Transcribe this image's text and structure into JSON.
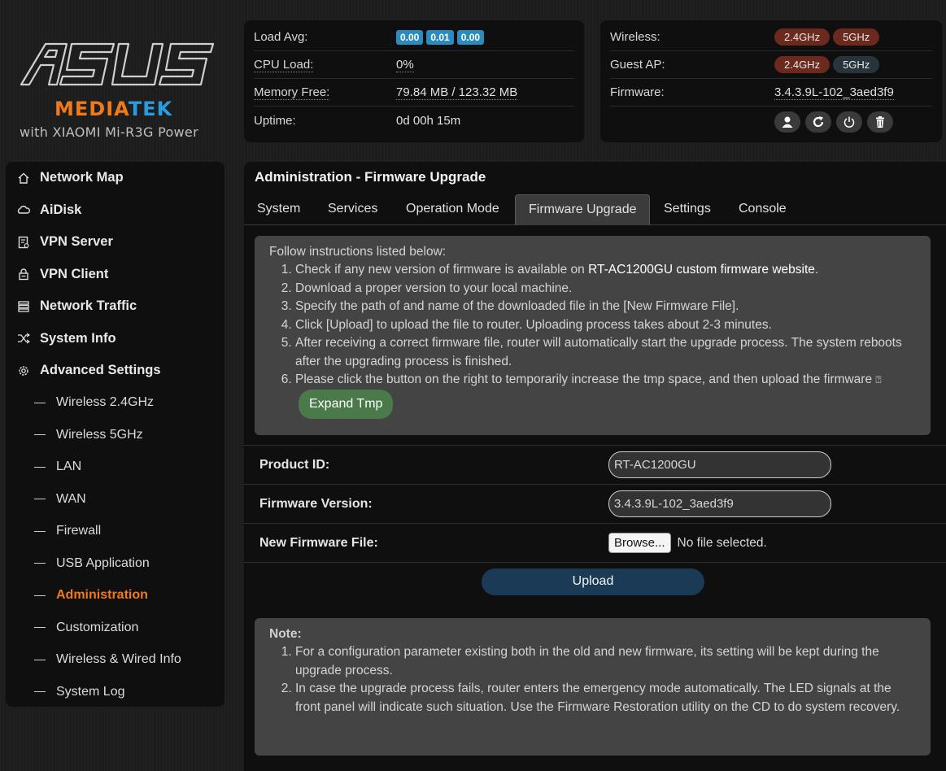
{
  "branding": {
    "logo_text": "ASUS",
    "mediatek_a": "MEDIA",
    "mediatek_b": "TEK",
    "tagline": "with XIAOMI Mi-R3G Power"
  },
  "status_left": {
    "load_avg_label": "Load Avg:",
    "load_avg_values": [
      "0.00",
      "0.01",
      "0.00"
    ],
    "cpu_label": "CPU Load:",
    "cpu_value": "0%",
    "mem_label": "Memory Free:",
    "mem_value": "79.84 MB / 123.32 MB",
    "uptime_label": "Uptime:",
    "uptime_value": "0d 00h 15m"
  },
  "status_right": {
    "wireless_label": "Wireless:",
    "wireless_24": "2.4GHz",
    "wireless_5": "5GHz",
    "guest_label": "Guest AP:",
    "guest_24": "2.4GHz",
    "guest_5": "5GHz",
    "firmware_label": "Firmware:",
    "firmware_value": "3.4.3.9L-102_3aed3f9",
    "icons": [
      "user-icon",
      "refresh-icon",
      "power-icon",
      "trash-icon"
    ]
  },
  "sidebar": {
    "items": [
      {
        "label": "Network Map",
        "icon": "home-icon"
      },
      {
        "label": "AiDisk",
        "icon": "cloud-icon"
      },
      {
        "label": "VPN Server",
        "icon": "vpn-server-icon"
      },
      {
        "label": "VPN Client",
        "icon": "lock-icon"
      },
      {
        "label": "Network Traffic",
        "icon": "list-icon"
      },
      {
        "label": "System Info",
        "icon": "shuffle-icon"
      },
      {
        "label": "Advanced Settings",
        "icon": "gear-icon"
      }
    ],
    "sub_items": [
      "Wireless 2.4GHz",
      "Wireless 5GHz",
      "LAN",
      "WAN",
      "Firewall",
      "USB Application",
      "Administration",
      "Customization",
      "Wireless & Wired Info",
      "System Log"
    ],
    "active_sub": "Administration"
  },
  "main": {
    "title": "Administration - Firmware Upgrade",
    "tabs": [
      "System",
      "Services",
      "Operation Mode",
      "Firmware Upgrade",
      "Settings",
      "Console"
    ],
    "active_tab": "Firmware Upgrade",
    "instructions": {
      "head": "Follow instructions listed below:",
      "step1_a": "Check if any new version of firmware is available on ",
      "step1_link": "RT-AC1200GU custom firmware website",
      "step1_b": ".",
      "step2": "Download a proper version to your local machine.",
      "step3": "Specify the path of and name of the downloaded file in the [New Firmware File].",
      "step4": "Click [Upload] to upload the file to router. Uploading process takes about 2-3 minutes.",
      "step5": "After receiving a correct firmware file, router will automatically start the upgrade process. The system reboots after the upgrading process is finished.",
      "step6": "Please click the button on the right to temporarily increase the tmp space, and then upload the firmware",
      "step6_glyph": "⍰",
      "expand_button": "Expand Tmp"
    },
    "form": {
      "product_id_label": "Product ID:",
      "product_id_value": "RT-AC1200GU",
      "fw_version_label": "Firmware Version:",
      "fw_version_value": "3.4.3.9L-102_3aed3f9",
      "new_file_label": "New Firmware File:",
      "browse_label": "Browse...",
      "no_file": "No file selected.",
      "upload_label": "Upload"
    },
    "note": {
      "head": "Note:",
      "item1": "For a configuration parameter existing both in the old and new firmware, its setting will be kept during the upgrade process.",
      "item2": "In case the upgrade process fails, router enters the emergency mode automatically. The LED signals at the front panel will indicate such situation. Use the Firmware Restoration utility on the CD to do system recovery."
    }
  }
}
